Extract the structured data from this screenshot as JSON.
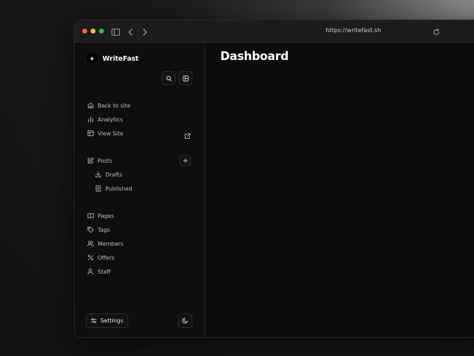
{
  "browser": {
    "url": "https://writefast.sh",
    "traffic_lights": {
      "close": "#ff5f57",
      "minimize": "#febc2e",
      "maximize": "#28c840"
    }
  },
  "sidebar": {
    "brand": "WriteFast",
    "items_top": [
      {
        "label": "Back to site",
        "icon": "home-icon"
      },
      {
        "label": "Analytics",
        "icon": "bar-chart-icon"
      },
      {
        "label": "View Site",
        "icon": "layout-icon"
      }
    ],
    "posts": {
      "label": "Posts",
      "children": [
        {
          "label": "Drafts",
          "icon": "download-icon"
        },
        {
          "label": "Published",
          "icon": "document-icon"
        }
      ]
    },
    "items_bottom": [
      {
        "label": "Pages",
        "icon": "book-icon"
      },
      {
        "label": "Tags",
        "icon": "tag-icon"
      },
      {
        "label": "Members",
        "icon": "users-icon"
      },
      {
        "label": "Offers",
        "icon": "percent-icon"
      },
      {
        "label": "Staff",
        "icon": "user-icon"
      }
    ],
    "settings_label": "Settings"
  },
  "main": {
    "title": "Dashboard"
  }
}
